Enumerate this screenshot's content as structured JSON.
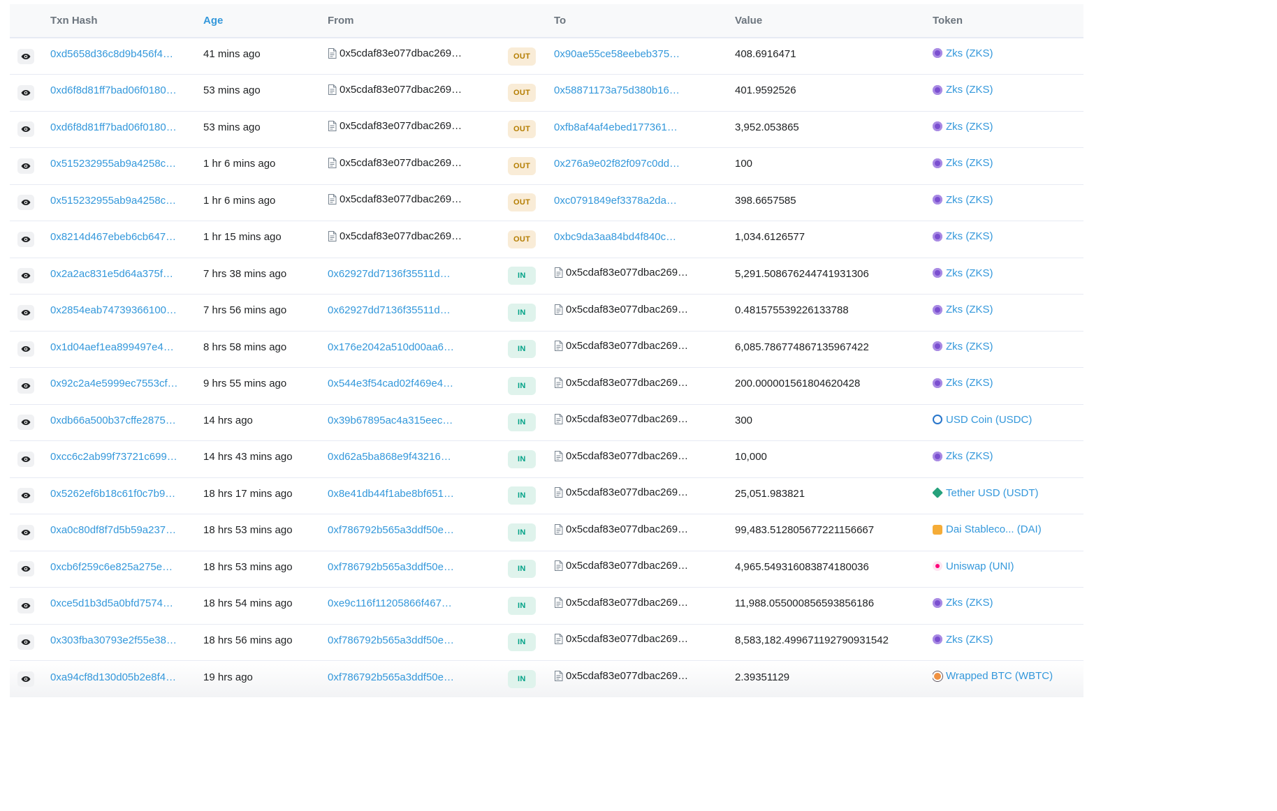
{
  "header": {
    "txn_hash": "Txn Hash",
    "age": "Age",
    "from": "From",
    "to": "To",
    "value": "Value",
    "token": "Token"
  },
  "rows": [
    {
      "hash": "0xd5658d36c8d9b456f4…",
      "age": "41 mins ago",
      "from": "0x5cdaf83e077dbac269…",
      "from_contract": true,
      "direction": "OUT",
      "to": "0x90ae55ce58eebeb375…",
      "to_contract": false,
      "value": "408.6916471",
      "token": "Zks (ZKS)",
      "token_icon": "zks-token-icon"
    },
    {
      "hash": "0xd6f8d81ff7bad06f0180…",
      "age": "53 mins ago",
      "from": "0x5cdaf83e077dbac269…",
      "from_contract": true,
      "direction": "OUT",
      "to": "0x58871173a75d380b16…",
      "to_contract": false,
      "value": "401.9592526",
      "token": "Zks (ZKS)",
      "token_icon": "zks-token-icon"
    },
    {
      "hash": "0xd6f8d81ff7bad06f0180…",
      "age": "53 mins ago",
      "from": "0x5cdaf83e077dbac269…",
      "from_contract": true,
      "direction": "OUT",
      "to": "0xfb8af4af4ebed177361…",
      "to_contract": false,
      "value": "3,952.053865",
      "token": "Zks (ZKS)",
      "token_icon": "zks-token-icon"
    },
    {
      "hash": "0x515232955ab9a4258c…",
      "age": "1 hr 6 mins ago",
      "from": "0x5cdaf83e077dbac269…",
      "from_contract": true,
      "direction": "OUT",
      "to": "0x276a9e02f82f097c0dd…",
      "to_contract": false,
      "value": "100",
      "token": "Zks (ZKS)",
      "token_icon": "zks-token-icon"
    },
    {
      "hash": "0x515232955ab9a4258c…",
      "age": "1 hr 6 mins ago",
      "from": "0x5cdaf83e077dbac269…",
      "from_contract": true,
      "direction": "OUT",
      "to": "0xc0791849ef3378a2da…",
      "to_contract": false,
      "value": "398.6657585",
      "token": "Zks (ZKS)",
      "token_icon": "zks-token-icon"
    },
    {
      "hash": "0x8214d467ebeb6cb647…",
      "age": "1 hr 15 mins ago",
      "from": "0x5cdaf83e077dbac269…",
      "from_contract": true,
      "direction": "OUT",
      "to": "0xbc9da3aa84bd4f840c…",
      "to_contract": false,
      "value": "1,034.6126577",
      "token": "Zks (ZKS)",
      "token_icon": "zks-token-icon"
    },
    {
      "hash": "0x2a2ac831e5d64a375f…",
      "age": "7 hrs 38 mins ago",
      "from": "0x62927dd7136f35511d…",
      "from_contract": false,
      "direction": "IN",
      "to": "0x5cdaf83e077dbac269…",
      "to_contract": true,
      "value": "5,291.508676244741931306",
      "token": "Zks (ZKS)",
      "token_icon": "zks-token-icon"
    },
    {
      "hash": "0x2854eab74739366100…",
      "age": "7 hrs 56 mins ago",
      "from": "0x62927dd7136f35511d…",
      "from_contract": false,
      "direction": "IN",
      "to": "0x5cdaf83e077dbac269…",
      "to_contract": true,
      "value": "0.481575539226133788",
      "token": "Zks (ZKS)",
      "token_icon": "zks-token-icon"
    },
    {
      "hash": "0x1d04aef1ea899497e4…",
      "age": "8 hrs 58 mins ago",
      "from": "0x176e2042a510d00aa6…",
      "from_contract": false,
      "direction": "IN",
      "to": "0x5cdaf83e077dbac269…",
      "to_contract": true,
      "value": "6,085.786774867135967422",
      "token": "Zks (ZKS)",
      "token_icon": "zks-token-icon"
    },
    {
      "hash": "0x92c2a4e5999ec7553cf…",
      "age": "9 hrs 55 mins ago",
      "from": "0x544e3f54cad02f469e4…",
      "from_contract": false,
      "direction": "IN",
      "to": "0x5cdaf83e077dbac269…",
      "to_contract": true,
      "value": "200.000001561804620428",
      "token": "Zks (ZKS)",
      "token_icon": "zks-token-icon"
    },
    {
      "hash": "0xdb66a500b37cffe2875…",
      "age": "14 hrs ago",
      "from": "0x39b67895ac4a315eec…",
      "from_contract": false,
      "direction": "IN",
      "to": "0x5cdaf83e077dbac269…",
      "to_contract": true,
      "value": "300",
      "token": "USD Coin (USDC)",
      "token_icon": "usdc-token-icon"
    },
    {
      "hash": "0xcc6c2ab99f73721c699…",
      "age": "14 hrs 43 mins ago",
      "from": "0xd62a5ba868e9f43216…",
      "from_contract": false,
      "direction": "IN",
      "to": "0x5cdaf83e077dbac269…",
      "to_contract": true,
      "value": "10,000",
      "token": "Zks (ZKS)",
      "token_icon": "zks-token-icon"
    },
    {
      "hash": "0x5262ef6b18c61f0c7b9…",
      "age": "18 hrs 17 mins ago",
      "from": "0x8e41db44f1abe8bf651…",
      "from_contract": false,
      "direction": "IN",
      "to": "0x5cdaf83e077dbac269…",
      "to_contract": true,
      "value": "25,051.983821",
      "token": "Tether USD (USDT)",
      "token_icon": "usdt-token-icon"
    },
    {
      "hash": "0xa0c80df8f7d5b59a237…",
      "age": "18 hrs 53 mins ago",
      "from": "0xf786792b565a3ddf50e…",
      "from_contract": false,
      "direction": "IN",
      "to": "0x5cdaf83e077dbac269…",
      "to_contract": true,
      "value": "99,483.512805677221156667",
      "token": "Dai Stableco... (DAI)",
      "token_icon": "dai-token-icon"
    },
    {
      "hash": "0xcb6f259c6e825a275e…",
      "age": "18 hrs 53 mins ago",
      "from": "0xf786792b565a3ddf50e…",
      "from_contract": false,
      "direction": "IN",
      "to": "0x5cdaf83e077dbac269…",
      "to_contract": true,
      "value": "4,965.549316083874180036",
      "token": "Uniswap (UNI)",
      "token_icon": "uni-token-icon"
    },
    {
      "hash": "0xce5d1b3d5a0bfd7574…",
      "age": "18 hrs 54 mins ago",
      "from": "0xe9c116f11205866f467…",
      "from_contract": false,
      "direction": "IN",
      "to": "0x5cdaf83e077dbac269…",
      "to_contract": true,
      "value": "11,988.055000856593856186",
      "token": "Zks (ZKS)",
      "token_icon": "zks-token-icon"
    },
    {
      "hash": "0x303fba30793e2f55e38…",
      "age": "18 hrs 56 mins ago",
      "from": "0xf786792b565a3ddf50e…",
      "from_contract": false,
      "direction": "IN",
      "to": "0x5cdaf83e077dbac269…",
      "to_contract": true,
      "value": "8,583,182.499671192790931542",
      "token": "Zks (ZKS)",
      "token_icon": "zks-token-icon"
    },
    {
      "hash": "0xa94cf8d130d05b2e8f4…",
      "age": "19 hrs ago",
      "from": "0xf786792b565a3ddf50e…",
      "from_contract": false,
      "direction": "IN",
      "to": "0x5cdaf83e077dbac269…",
      "to_contract": true,
      "value": "2.39351129",
      "token": "Wrapped BTC (WBTC)",
      "token_icon": "wbtc-token-icon"
    }
  ]
}
